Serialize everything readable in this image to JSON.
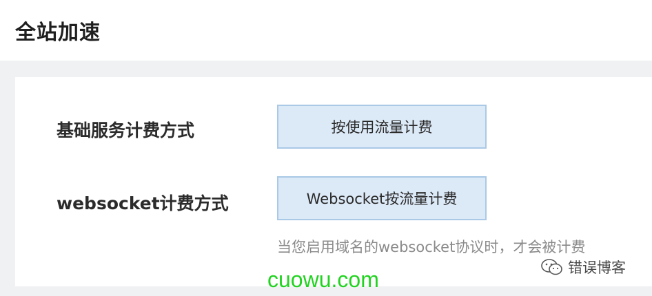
{
  "header": {
    "title": "全站加速"
  },
  "billing": {
    "basic_label": "基础服务计费方式",
    "basic_option": "按使用流量计费",
    "websocket_label": "websocket计费方式",
    "websocket_option": "Websocket按流量计费",
    "websocket_hint": "当您启用域名的websocket协议时，才会被计费"
  },
  "watermarks": {
    "account_name": "错误博客",
    "account_icon": "wechat-icon",
    "site": "cuowu.com",
    "site_color": "#21d320"
  }
}
